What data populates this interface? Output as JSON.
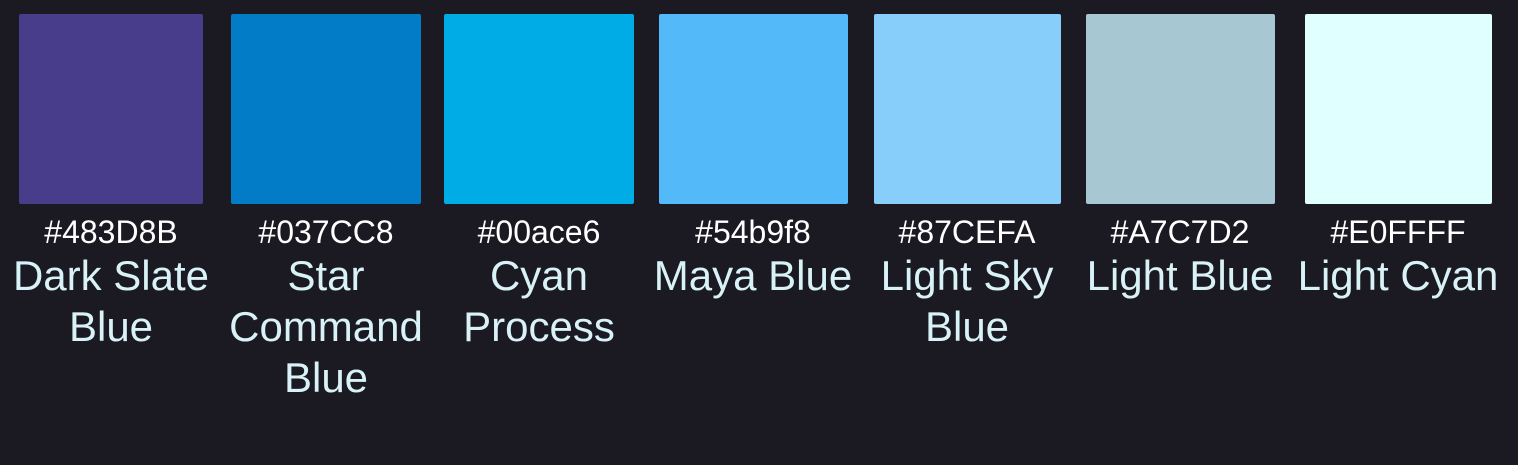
{
  "swatches": [
    {
      "hex": "#483D8B",
      "name": "Dark Slate Blue",
      "color": "#483D8B"
    },
    {
      "hex": "#037CC8",
      "name": "Star Command Blue",
      "color": "#037CC8"
    },
    {
      "hex": "#00ace6",
      "name": "Cyan Process",
      "color": "#00ACE6"
    },
    {
      "hex": "#54b9f8",
      "name": "Maya Blue",
      "color": "#54B9F8"
    },
    {
      "hex": "#87CEFA",
      "name": "Light Sky Blue",
      "color": "#87CEFA"
    },
    {
      "hex": "#A7C7D2",
      "name": "Light Blue",
      "color": "#A7C7D2"
    },
    {
      "hex": "#E0FFFF",
      "name": "Light Cyan",
      "color": "#E0FFFF"
    }
  ]
}
